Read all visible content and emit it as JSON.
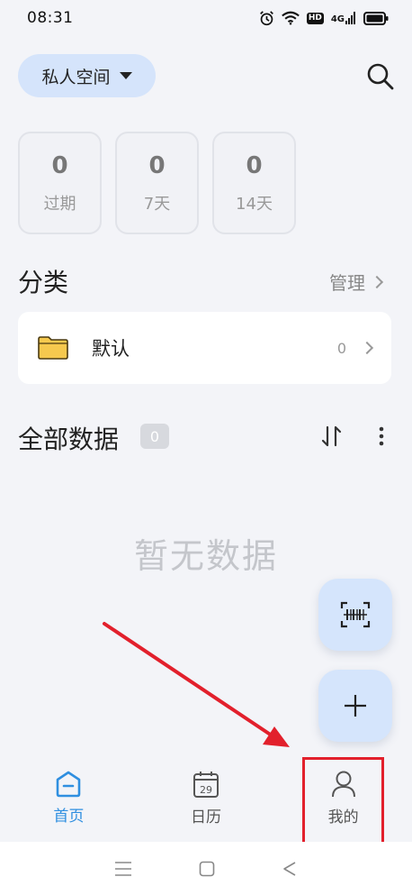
{
  "status_bar": {
    "time": "08:31",
    "network": "4G",
    "hd": "HD"
  },
  "header": {
    "space_selector_label": "私人空间"
  },
  "stats": [
    {
      "value": "0",
      "label": "过期"
    },
    {
      "value": "0",
      "label": "7天"
    },
    {
      "value": "0",
      "label": "14天"
    }
  ],
  "category_section": {
    "title": "分类",
    "manage_label": "管理",
    "items": [
      {
        "name": "默认",
        "count": "0"
      }
    ]
  },
  "data_section": {
    "title": "全部数据",
    "count": "0",
    "empty_text": "暂无数据"
  },
  "bottom_nav": {
    "items": [
      {
        "label": "首页",
        "active": true
      },
      {
        "label": "日历",
        "active": false,
        "icon_text": "29"
      },
      {
        "label": "我的",
        "active": false
      }
    ]
  },
  "colors": {
    "accent": "#2f8fe0",
    "fab_bg": "#d5e5fc",
    "selector_bg": "#d5e4fb",
    "highlight": "#e2202c",
    "folder": "#f6c94e"
  }
}
